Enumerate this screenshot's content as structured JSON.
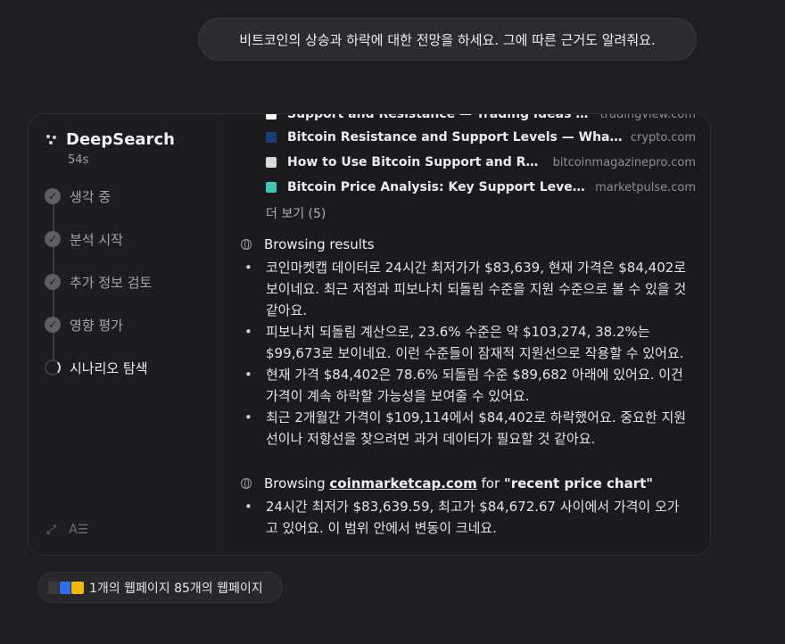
{
  "user_message": "비트코인의 상승과 하락에 대한 전망을 하세요. 그에 따른 근거도 알려줘요.",
  "sidebar": {
    "title": "DeepSearch",
    "elapsed": "54s",
    "steps": [
      {
        "label": "생각 중",
        "state": "done"
      },
      {
        "label": "분석 시작",
        "state": "done"
      },
      {
        "label": "추가 정보 검토",
        "state": "done"
      },
      {
        "label": "영향 평가",
        "state": "done"
      },
      {
        "label": "시나리오 탐색",
        "state": "active"
      }
    ],
    "tools": {
      "expand_icon": "expand-icon",
      "format_icon": "text-format-icon",
      "format_label": "A☰"
    }
  },
  "sources": [
    {
      "title": "Support and Resistance — Trading Ideas on Tradi...",
      "domain": "tradingview.com",
      "color": "#ffffff"
    },
    {
      "title": "Bitcoin Resistance and Support Levels — What They Are...",
      "domain": "crypto.com",
      "color": "#1f3b7a"
    },
    {
      "title": "How to Use Bitcoin Support and Resistance ...",
      "domain": "bitcoinmagazinepro.com",
      "color": "#d9d9d9"
    },
    {
      "title": "Bitcoin Price Analysis: Key Support Levels and Mar...",
      "domain": "marketpulse.com",
      "color": "#3fc7b4"
    }
  ],
  "more_label": "더 보기 (5)",
  "browsing_results": {
    "heading": "Browsing results",
    "bullets": [
      "코인마켓캡 데이터로 24시간 최저가가 $83,639, 현재 가격은 $84,402로 보이네요. 최근 저점과 피보나치 되돌림 수준을 지원 수준으로 볼 수 있을 것 같아요.",
      "피보나치 되돌림 계산으로, 23.6% 수준은 약 $103,274, 38.2%는 $99,673로 보이네요. 이런 수준들이 잠재적 지원선으로 작용할 수 있어요.",
      "현재 가격 $84,402은 78.6% 되돌림 수준 $89,682 아래에 있어요. 이건 가격이 계속 하락할 가능성을 보여줄 수 있어요.",
      "최근 2개월간 가격이 $109,114에서 $84,402로 하락했어요. 중요한 지원선이나 저항선을 찾으려면 과거 데이터가 필요할 것 같아요."
    ]
  },
  "browsing_site": {
    "prefix": "Browsing",
    "site": "coinmarketcap.com",
    "for": "for",
    "query": "\"recent price chart\"",
    "bullets": [
      "24시간 최저가 $83,639.59, 최고가 $84,672.67 사이에서 가격이 오가고 있어요. 이 범위 안에서 변동이 크네요."
    ]
  },
  "footer_pill": {
    "label": "1개의 웹페이지 85개의 웹페이지",
    "favicons": [
      "#3a3a3a",
      "#2f6fed",
      "#f0b90b"
    ]
  }
}
